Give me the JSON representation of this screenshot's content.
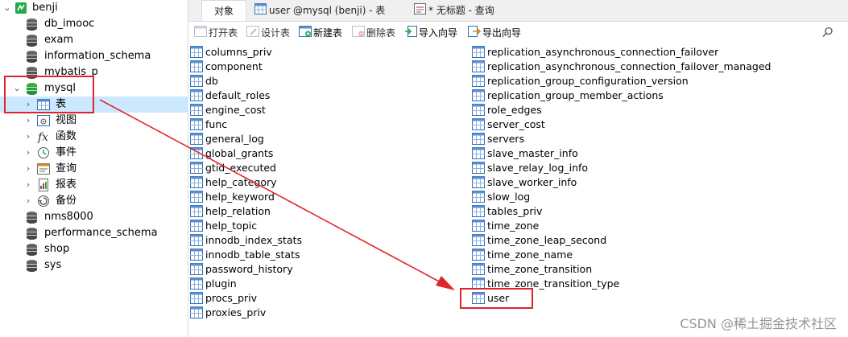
{
  "tree": {
    "connection": "benji",
    "items": [
      {
        "label": "db_imooc",
        "type": "db"
      },
      {
        "label": "exam",
        "type": "db"
      },
      {
        "label": "information_schema",
        "type": "db"
      },
      {
        "label": "mybatis_p",
        "type": "db"
      },
      {
        "label": "mysql",
        "type": "db-open"
      },
      {
        "label": "表",
        "type": "tables"
      },
      {
        "label": "视图",
        "type": "views"
      },
      {
        "label": "函数",
        "type": "functions"
      },
      {
        "label": "事件",
        "type": "events"
      },
      {
        "label": "查询",
        "type": "queries"
      },
      {
        "label": "报表",
        "type": "reports"
      },
      {
        "label": "备份",
        "type": "backups"
      },
      {
        "label": "nms8000",
        "type": "db"
      },
      {
        "label": "performance_schema",
        "type": "db"
      },
      {
        "label": "shop",
        "type": "db"
      },
      {
        "label": "sys",
        "type": "db"
      }
    ]
  },
  "tabs": {
    "objects": "对象",
    "table_tab": "user @mysql (benji) - 表",
    "query_tab": "* 无标题 - 查询"
  },
  "toolbar": {
    "open": "打开表",
    "design": "设计表",
    "new": "新建表",
    "delete": "删除表",
    "import": "导入向导",
    "export": "导出向导"
  },
  "tables_left": [
    "columns_priv",
    "component",
    "db",
    "default_roles",
    "engine_cost",
    "func",
    "general_log",
    "global_grants",
    "gtid_executed",
    "help_category",
    "help_keyword",
    "help_relation",
    "help_topic",
    "innodb_index_stats",
    "innodb_table_stats",
    "password_history",
    "plugin",
    "procs_priv",
    "proxies_priv"
  ],
  "tables_right": [
    "replication_asynchronous_connection_failover",
    "replication_asynchronous_connection_failover_managed",
    "replication_group_configuration_version",
    "replication_group_member_actions",
    "role_edges",
    "server_cost",
    "servers",
    "slave_master_info",
    "slave_relay_log_info",
    "slave_worker_info",
    "slow_log",
    "tables_priv",
    "time_zone",
    "time_zone_leap_second",
    "time_zone_name",
    "time_zone_transition",
    "time_zone_transition_type",
    "user"
  ],
  "watermark": "CSDN @稀土掘金技术社区",
  "colors": {
    "accent": "#cce8ff",
    "annotation": "#e0242b",
    "db_active": "#1c8a2c"
  }
}
